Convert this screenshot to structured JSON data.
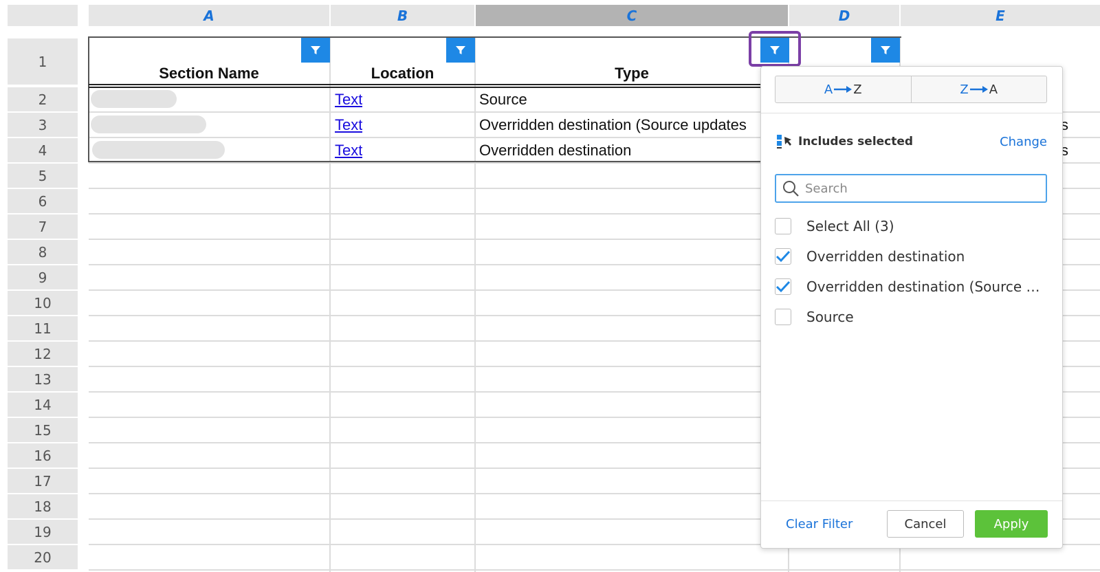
{
  "columns": [
    "A",
    "B",
    "C",
    "D",
    "E"
  ],
  "rows": [
    "1",
    "2",
    "3",
    "4",
    "5",
    "6",
    "7",
    "8",
    "9",
    "10",
    "11",
    "12",
    "13",
    "14",
    "15",
    "16",
    "17",
    "18",
    "19",
    "20"
  ],
  "headers": {
    "section_name": "Section Name",
    "location": "Location",
    "type": "Type"
  },
  "data_rows": [
    {
      "location": "Text",
      "type": "Source"
    },
    {
      "location": "Text",
      "type": "Overridden destination (Source updates"
    },
    {
      "location": "Text",
      "type": "Overridden destination"
    }
  ],
  "overflow": {
    "row3": "s",
    "row4": "s"
  },
  "filter_panel": {
    "sort_az": {
      "from": "A",
      "to": "Z"
    },
    "sort_za": {
      "from": "Z",
      "to": "A"
    },
    "includes_selected": "Includes selected",
    "change": "Change",
    "search_placeholder": "Search",
    "options": [
      {
        "label": "Select All (3)",
        "checked": false
      },
      {
        "label": "Overridden destination",
        "checked": true
      },
      {
        "label": "Overridden destination (Source u...",
        "checked": true
      },
      {
        "label": "Source",
        "checked": false
      }
    ],
    "clear_filter": "Clear Filter",
    "cancel": "Cancel",
    "apply": "Apply"
  },
  "colors": {
    "accent": "#1e88e5",
    "apply": "#5cc23a",
    "highlight": "#7b3fa6",
    "link": "#1a0dde"
  }
}
